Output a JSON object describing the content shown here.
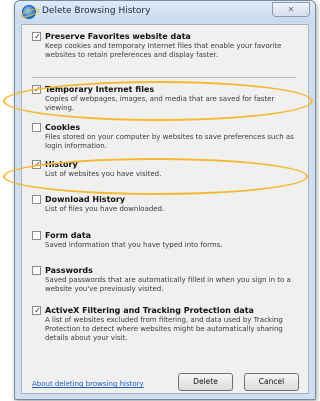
{
  "window": {
    "title": "Delete Browsing History",
    "close_glyph": "✕",
    "icon": "internet-explorer-icon"
  },
  "options": [
    {
      "id": "preserve-favorites",
      "label": "Preserve Favorites website data",
      "checked": true,
      "description": "Keep cookies and temporary Internet files that enable your favorite websites to retain preferences and display faster."
    },
    {
      "id": "temporary-internet-files",
      "label": "Temporary Internet files",
      "checked": true,
      "description": "Copies of webpages, images, and media that are saved for faster viewing."
    },
    {
      "id": "cookies",
      "label": "Cookies",
      "checked": false,
      "description": "Files stored on your computer by websites to save preferences such as login information."
    },
    {
      "id": "history",
      "label": "History",
      "checked": true,
      "description": "List of websites you have visited."
    },
    {
      "id": "download-history",
      "label": "Download History",
      "checked": false,
      "description": "List of files you have downloaded."
    },
    {
      "id": "form-data",
      "label": "Form data",
      "checked": false,
      "description": "Saved information that you have typed into forms."
    },
    {
      "id": "passwords",
      "label": "Passwords",
      "checked": false,
      "description": "Saved passwords that are automatically filled in when you sign in to a website you've previously visited."
    },
    {
      "id": "activex-filtering",
      "label": "ActiveX Filtering and Tracking Protection data",
      "checked": true,
      "description": "A list of websites excluded from filtering, and data used by Tracking Protection to detect where websites might be automatically sharing details about your visit."
    }
  ],
  "footer": {
    "link_text": "About deleting browsing history",
    "delete_label": "Delete",
    "cancel_label": "Cancel"
  },
  "colors": {
    "highlight": "#f5b82e",
    "link": "#1f5fb2"
  }
}
